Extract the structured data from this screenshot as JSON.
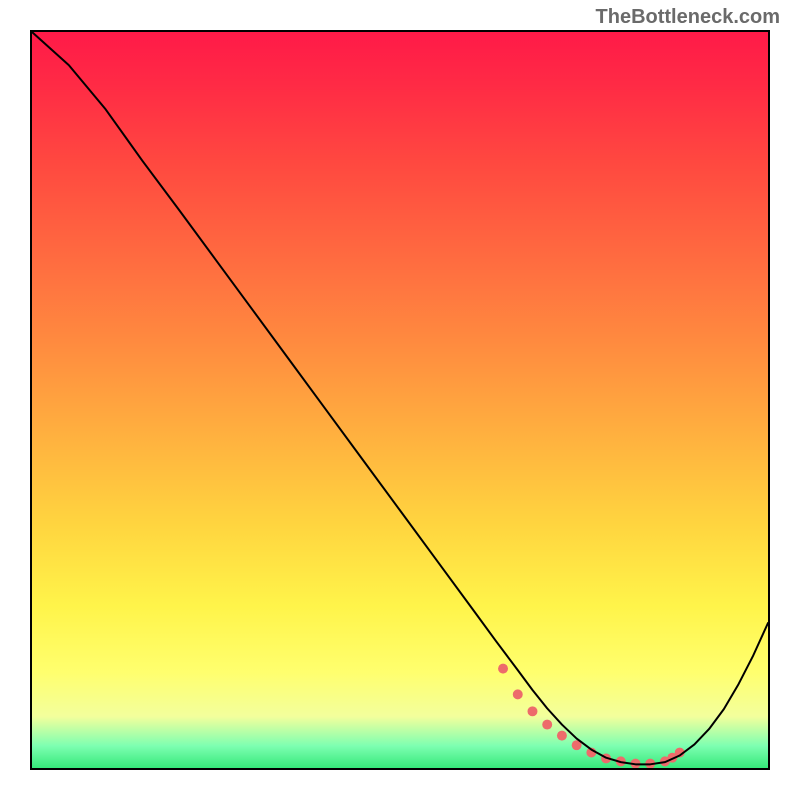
{
  "watermark": "TheBottleneck.com",
  "chart_data": {
    "type": "line",
    "title": "",
    "xlabel": "",
    "ylabel": "",
    "xlim": [
      0,
      100
    ],
    "ylim": [
      0,
      100
    ],
    "series": [
      {
        "name": "curve",
        "x": [
          0,
          5,
          10,
          15,
          20,
          25,
          30,
          35,
          40,
          45,
          50,
          55,
          60,
          63,
          66,
          68,
          70,
          72,
          74,
          76,
          78,
          80,
          82,
          84,
          86,
          88,
          90,
          92,
          94,
          96,
          98,
          100
        ],
        "y": [
          100,
          95.5,
          89.5,
          82.5,
          75.8,
          69,
          62.2,
          55.4,
          48.6,
          41.8,
          35,
          28.2,
          21.4,
          17.3,
          13.3,
          10.6,
          8.1,
          5.9,
          4.0,
          2.5,
          1.4,
          0.8,
          0.5,
          0.5,
          0.8,
          1.7,
          3.2,
          5.3,
          8.0,
          11.4,
          15.3,
          19.7
        ]
      }
    ],
    "markers": {
      "name": "highlight-band",
      "x": [
        64,
        66,
        68,
        70,
        72,
        74,
        76,
        78,
        80,
        82,
        84,
        86,
        87,
        88
      ],
      "y": [
        13.5,
        10.0,
        7.7,
        5.9,
        4.4,
        3.1,
        2.1,
        1.3,
        0.9,
        0.6,
        0.6,
        0.9,
        1.4,
        2.1
      ],
      "color": "#ed6b6b",
      "radius": 5
    }
  }
}
